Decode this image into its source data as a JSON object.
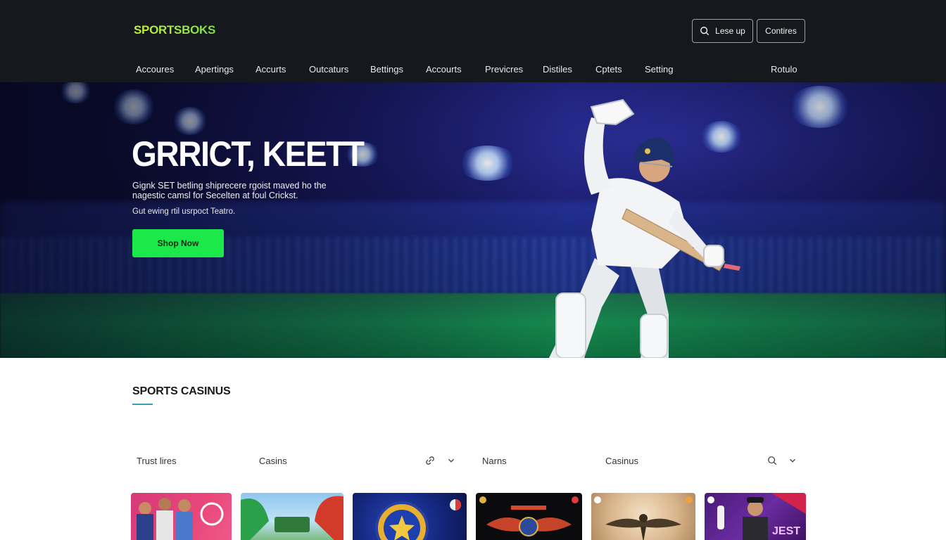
{
  "header": {
    "logo": "SPORTSBOKS",
    "login_label": "Lese up",
    "continue_label": "Contires"
  },
  "nav": {
    "items": [
      "Accoures",
      "Apertings",
      "Accurts",
      "Outcaturs",
      "Bettings",
      "Accourts",
      "Previcres",
      "Distiles",
      "Cptets",
      "Setting"
    ],
    "right_item": "Rotulo"
  },
  "hero": {
    "title": "GRRICT, KEETT",
    "subtitle": "Gignk SET betling shiprecere rgoist maved ho the nagestic camsl for Secelten at foul Crickst.",
    "note": "Gut ewing rtil usrpoct Teatro.",
    "cta_label": "Shop Now"
  },
  "section": {
    "title": "SPORTS CASINUS",
    "filters": [
      "Trust lires",
      "Casins",
      "Narns",
      "Casinus"
    ]
  },
  "cards": {
    "items": [
      {
        "name": "card-1",
        "label": ""
      },
      {
        "name": "card-2",
        "label": ""
      },
      {
        "name": "card-3",
        "label": ""
      },
      {
        "name": "card-4",
        "label": ""
      },
      {
        "name": "card-5",
        "label": ""
      },
      {
        "name": "card-6",
        "label": "JEST"
      }
    ]
  },
  "colors": {
    "header_bg": "#15181c",
    "accent_green": "#1de84a",
    "underline": "#3aa0b8"
  },
  "icons": [
    "search-icon",
    "link-icon",
    "chevron-down-icon",
    "search-icon",
    "chevron-down-icon"
  ]
}
